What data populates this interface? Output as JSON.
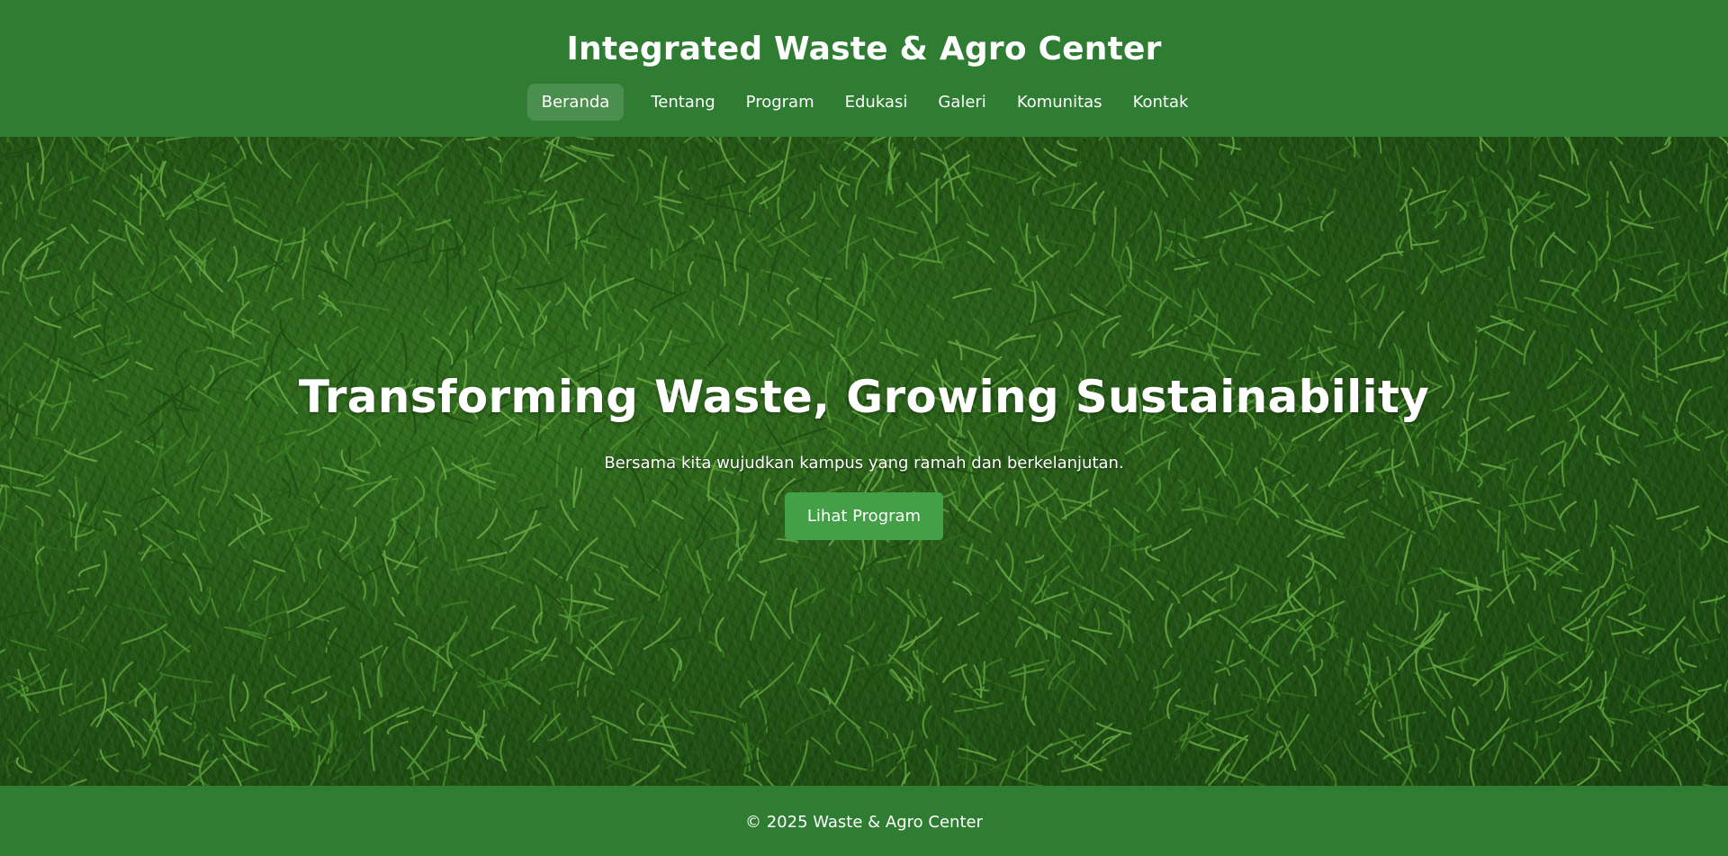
{
  "header": {
    "site_title": "Integrated Waste & Agro Center",
    "nav": [
      {
        "label": "Beranda",
        "active": true
      },
      {
        "label": "Tentang",
        "active": false
      },
      {
        "label": "Program",
        "active": false
      },
      {
        "label": "Edukasi",
        "active": false
      },
      {
        "label": "Galeri",
        "active": false
      },
      {
        "label": "Komunitas",
        "active": false
      },
      {
        "label": "Kontak",
        "active": false
      }
    ]
  },
  "hero": {
    "title": "Transforming Waste, Growing Sustainability",
    "subtitle": "Bersama kita wujudkan kampus yang ramah dan berkelanjutan.",
    "cta_label": "Lihat Program"
  },
  "footer": {
    "copyright": "© 2025 Waste & Agro Center"
  },
  "colors": {
    "primary_green": "#2e7d32",
    "button_green": "#43a047",
    "text": "#ffffff"
  }
}
